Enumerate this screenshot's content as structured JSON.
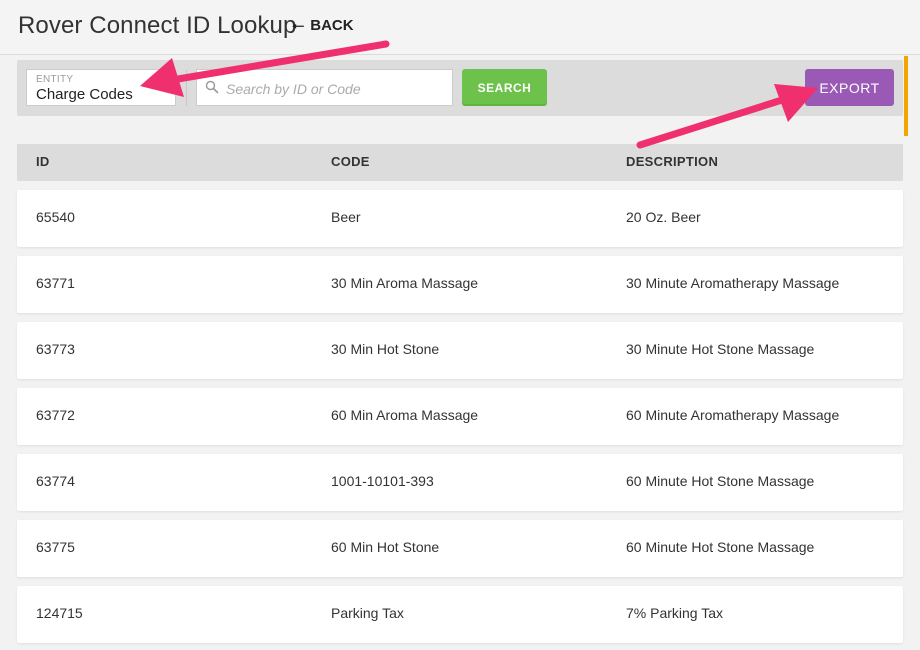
{
  "header": {
    "title": "Rover Connect ID Lookup",
    "back_label": "BACK"
  },
  "toolbar": {
    "entity_label": "ENTITY",
    "entity_value": "Charge Codes",
    "search_placeholder": "Search by ID or Code",
    "search_value": "",
    "search_button": "SEARCH",
    "export_button": "EXPORT"
  },
  "table": {
    "headers": {
      "id": "ID",
      "code": "CODE",
      "description": "DESCRIPTION"
    },
    "rows": [
      {
        "id": "65540",
        "code": "Beer",
        "description": "20 Oz. Beer"
      },
      {
        "id": "63771",
        "code": "30 Min Aroma Massage",
        "description": "30 Minute Aromatherapy Massage"
      },
      {
        "id": "63773",
        "code": "30 Min Hot Stone",
        "description": "30 Minute Hot Stone Massage"
      },
      {
        "id": "63772",
        "code": "60 Min Aroma Massage",
        "description": "60 Minute Aromatherapy Massage"
      },
      {
        "id": "63774",
        "code": "1001-10101-393",
        "description": "60 Minute Hot Stone Massage"
      },
      {
        "id": "63775",
        "code": "60 Min Hot Stone",
        "description": "60 Minute Hot Stone Massage"
      },
      {
        "id": "124715",
        "code": "Parking Tax",
        "description": "7% Parking Tax"
      }
    ]
  },
  "colors": {
    "search_button": "#6cc24a",
    "export_button": "#9b59b6",
    "annotation_arrow": "#f0306e",
    "scroll_accent": "#f0a500"
  },
  "icons": {
    "back": "left-arrow-icon",
    "search": "magnifier-icon"
  }
}
